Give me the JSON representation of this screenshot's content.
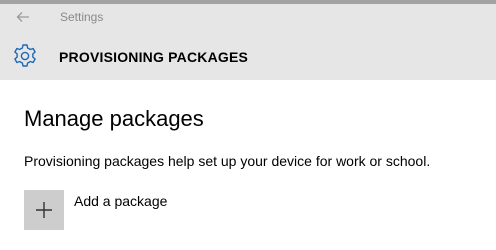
{
  "window": {
    "title": "Settings"
  },
  "header": {
    "icon": "gear-icon",
    "title": "PROVISIONING PACKAGES"
  },
  "main": {
    "page_title": "Manage packages",
    "description": "Provisioning packages help set up your device for work or school.",
    "add_package_label": "Add a package",
    "add_icon": "plus-icon"
  },
  "colors": {
    "chrome_background": "#e6e6e6",
    "accent": "#1b69b6",
    "tile_background": "#cdcdcd"
  }
}
